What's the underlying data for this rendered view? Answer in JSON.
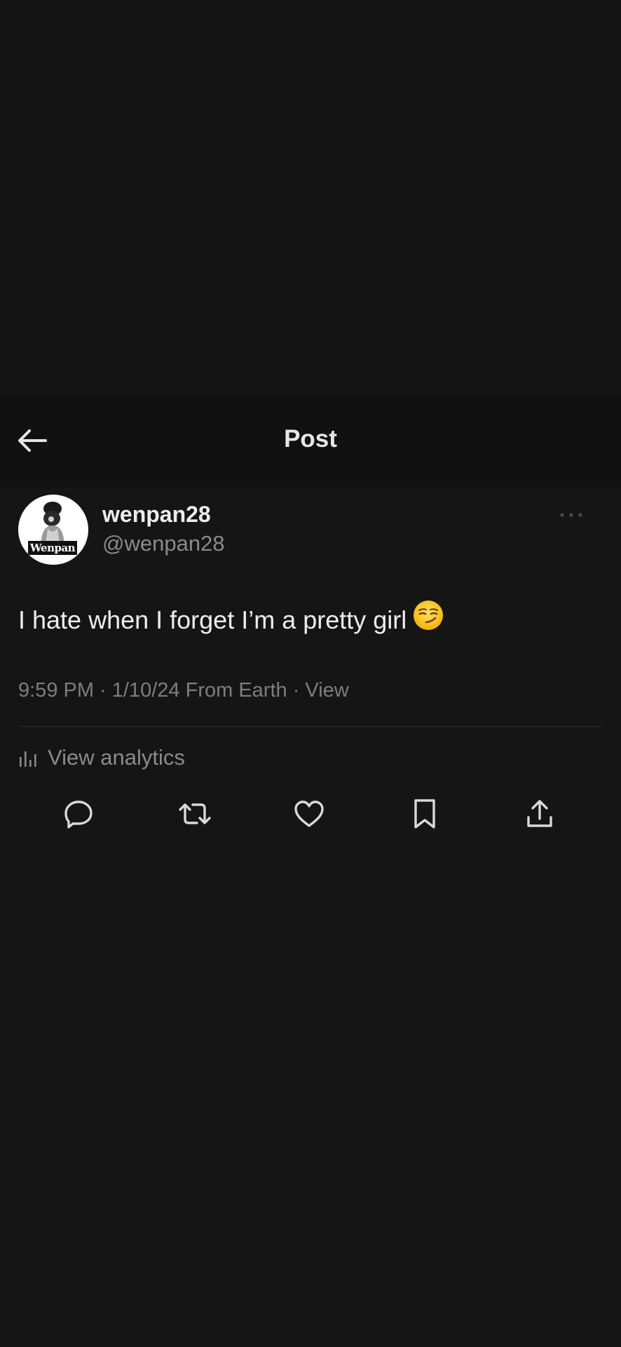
{
  "header": {
    "title": "Post",
    "back_icon": "arrow-left-icon"
  },
  "author": {
    "display_name": "wenpan28",
    "handle": "@wenpan28",
    "avatar_label": "Wenpan"
  },
  "post": {
    "text": "I hate when I forget I’m a pretty girl",
    "emoji": "smirking-face-emoji"
  },
  "meta": {
    "time": "9:59 PM",
    "sep1": " · ",
    "date": "1/10/24",
    "location": " From Earth",
    "sep2": " · ",
    "view_label": "View"
  },
  "analytics": {
    "label": "View analytics",
    "icon": "bar-chart-icon"
  },
  "actions": [
    {
      "name": "reply",
      "icon": "reply-icon"
    },
    {
      "name": "repost",
      "icon": "repost-icon"
    },
    {
      "name": "like",
      "icon": "heart-icon"
    },
    {
      "name": "bookmark",
      "icon": "bookmark-icon"
    },
    {
      "name": "share",
      "icon": "share-icon"
    }
  ],
  "colors": {
    "background": "#161516",
    "header_bg": "#121112",
    "primary_text": "#ededed",
    "secondary_text": "#8a8a8c",
    "icon": "#d9d9d9"
  }
}
